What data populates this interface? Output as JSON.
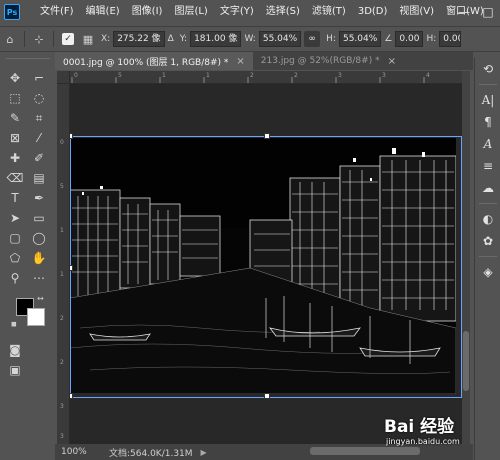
{
  "menubar": {
    "logo": "Ps",
    "items": [
      "文件(F)",
      "编辑(E)",
      "图像(I)",
      "图层(L)",
      "文字(Y)",
      "选择(S)",
      "滤镜(T)",
      "3D(D)",
      "视图(V)",
      "窗口(W)"
    ],
    "minimize": "—",
    "maximize": "□"
  },
  "options": {
    "x_label": "X:",
    "x_value": "275.22 像",
    "delta_label": "Δ",
    "y_label": "Y:",
    "y_value": "181.00 像",
    "w_label": "W:",
    "w_value": "55.04%",
    "link": "∞",
    "h_label": "H:",
    "h_value": "55.04%",
    "angle_label": "∠",
    "angle_value": "0.00",
    "h2_label": "H:",
    "h2_value": "0.00"
  },
  "tabs": [
    {
      "label": "0001.jpg @ 100% (图层 1, RGB/8#) *",
      "close": "×"
    },
    {
      "label": "213.jpg @ 52%(RGB/8#) *",
      "close": "×"
    }
  ],
  "status": {
    "zoom": "100%",
    "doc_info": "文档:564.0K/1.31M",
    "arrow": "▶"
  },
  "ruler_top": [
    "0",
    "5",
    "1",
    "1",
    "2",
    "2",
    "3",
    "3",
    "4"
  ],
  "ruler_left": [
    "0",
    "5",
    "1",
    "1",
    "2",
    "2",
    "3",
    "3"
  ],
  "watermark": {
    "logo": "Bai 经验",
    "url": "jingyan.baidu.com"
  },
  "icons": {
    "move": "move-icon",
    "marquee": "rect-marquee-icon",
    "lasso": "lasso-icon"
  }
}
